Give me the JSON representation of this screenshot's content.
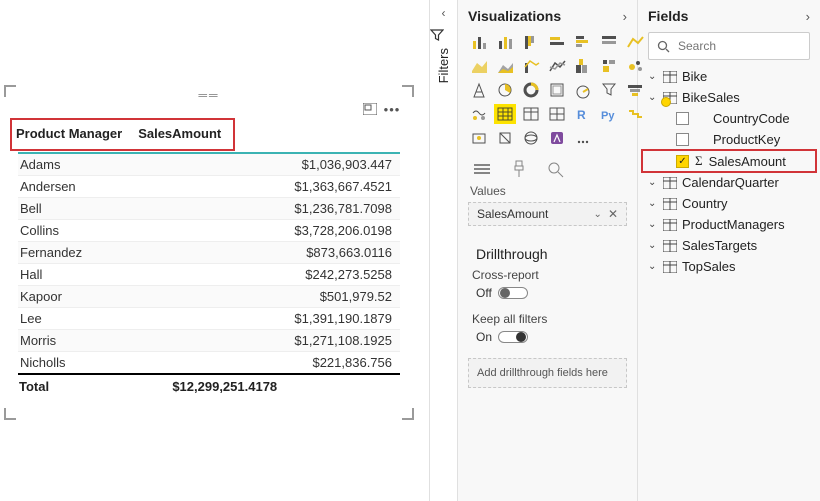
{
  "filters_tab": "Filters",
  "visual_table": {
    "columns": [
      "Product Manager",
      "SalesAmount"
    ],
    "rows": [
      {
        "pm": "Adams",
        "amt": "$1,036,903.447"
      },
      {
        "pm": "Andersen",
        "amt": "$1,363,667.4521"
      },
      {
        "pm": "Bell",
        "amt": "$1,236,781.7098"
      },
      {
        "pm": "Collins",
        "amt": "$3,728,206.0198"
      },
      {
        "pm": "Fernandez",
        "amt": "$873,663.0116"
      },
      {
        "pm": "Hall",
        "amt": "$242,273.5258"
      },
      {
        "pm": "Kapoor",
        "amt": "$501,979.52"
      },
      {
        "pm": "Lee",
        "amt": "$1,391,190.1879"
      },
      {
        "pm": "Morris",
        "amt": "$1,271,108.1925"
      },
      {
        "pm": "Nicholls",
        "amt": "$221,836.756"
      }
    ],
    "total_label": "Total",
    "total_value": "$12,299,251.4178"
  },
  "viz_pane": {
    "title": "Visualizations",
    "values_label": "Values",
    "value_field": "SalesAmount",
    "drill_header": "Drillthrough",
    "cross_report": "Cross-report",
    "off_label": "Off",
    "keep_filters": "Keep all filters",
    "on_label": "On",
    "add_placeholder": "Add drillthrough fields here"
  },
  "fields_pane": {
    "title": "Fields",
    "search_placeholder": "Search",
    "tables": {
      "bike": "Bike",
      "bikesales": "BikeSales",
      "bikesales_children": {
        "country": "CountryCode",
        "productkey": "ProductKey",
        "salesamount": "SalesAmount"
      },
      "calendarquarter": "CalendarQuarter",
      "country": "Country",
      "productmanagers": "ProductManagers",
      "salestargets": "SalesTargets",
      "topsales": "TopSales"
    }
  }
}
